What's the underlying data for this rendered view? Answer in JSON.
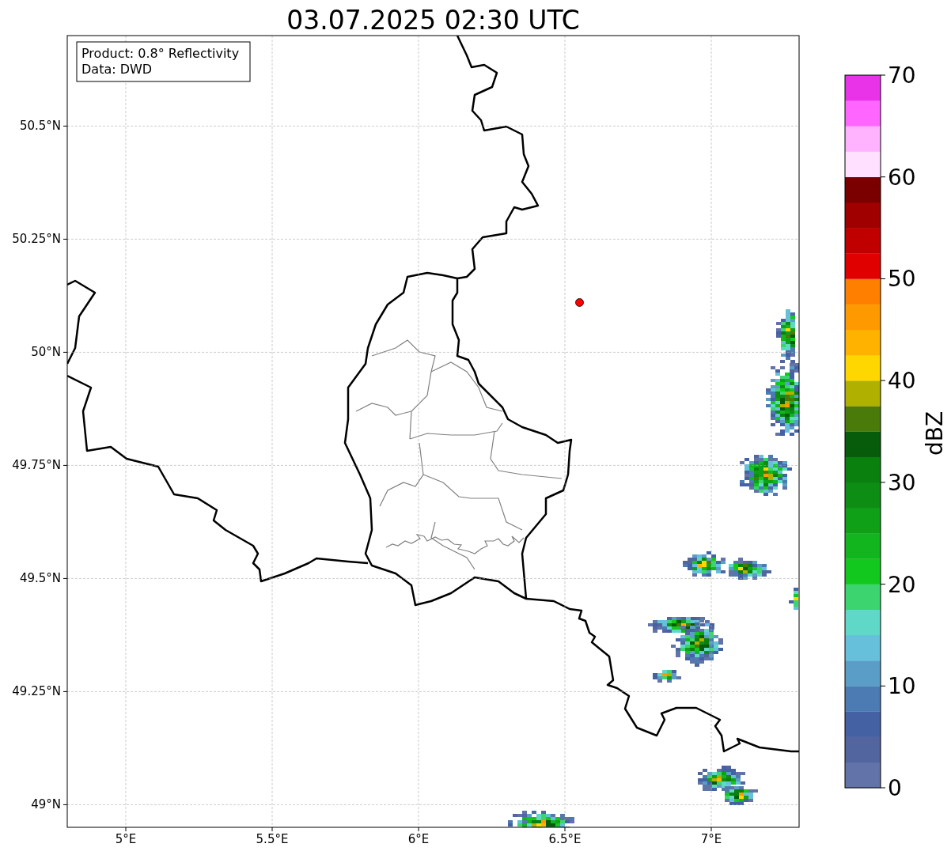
{
  "map": {
    "chart_data": {
      "type": "scatter",
      "title": "03.07.2025 02:30 UTC",
      "xlim": [
        4.8,
        7.3
      ],
      "ylim": [
        48.95,
        50.7
      ],
      "xticks": [
        {
          "value": 5,
          "label": "5°E"
        },
        {
          "value": 5.5,
          "label": "5.5°E"
        },
        {
          "value": 6,
          "label": "6°E"
        },
        {
          "value": 6.5,
          "label": "6.5°E"
        },
        {
          "value": 7,
          "label": "7°E"
        }
      ],
      "yticks": [
        {
          "value": 49,
          "label": "49°N"
        },
        {
          "value": 49.25,
          "label": "49.25°N"
        },
        {
          "value": 49.5,
          "label": "49.5°N"
        },
        {
          "value": 49.75,
          "label": "49.75°N"
        },
        {
          "value": 50,
          "label": "50°N"
        },
        {
          "value": 50.25,
          "label": "50.25°N"
        },
        {
          "value": 50.5,
          "label": "50.5°N"
        }
      ],
      "grid": true,
      "x": [
        6.55
      ],
      "series": [
        {
          "color": "#ff0000",
          "values": [
            50.11
          ]
        }
      ],
      "annotations": [
        "Product: 0.8° Reflectivity",
        "Data: DWD"
      ]
    }
  },
  "colorbar": {
    "label": "dBZ",
    "ticks": [
      "70",
      "60",
      "50",
      "40",
      "30",
      "20",
      "10",
      "0"
    ],
    "segments": [
      {
        "color": "#6173a8"
      },
      {
        "color": "#52659f"
      },
      {
        "color": "#4461a3"
      },
      {
        "color": "#4c7bb3"
      },
      {
        "color": "#5a9ec8"
      },
      {
        "color": "#66c0dc"
      },
      {
        "color": "#60d8c8"
      },
      {
        "color": "#3cd46e"
      },
      {
        "color": "#12c81e"
      },
      {
        "color": "#12b51e"
      },
      {
        "color": "#0fa018"
      },
      {
        "color": "#0d8d14"
      },
      {
        "color": "#0a800f"
      },
      {
        "color": "#075c0b"
      },
      {
        "color": "#4a7a0a"
      },
      {
        "color": "#b0b000"
      },
      {
        "color": "#ffd700"
      },
      {
        "color": "#ffb300"
      },
      {
        "color": "#ff9900"
      },
      {
        "color": "#ff7f00"
      },
      {
        "color": "#e00000"
      },
      {
        "color": "#c00000"
      },
      {
        "color": "#a00000"
      },
      {
        "color": "#7a0000"
      },
      {
        "color": "#ffe0ff"
      },
      {
        "color": "#ffb3ff"
      },
      {
        "color": "#ff66ff"
      },
      {
        "color": "#e833e8"
      }
    ]
  }
}
